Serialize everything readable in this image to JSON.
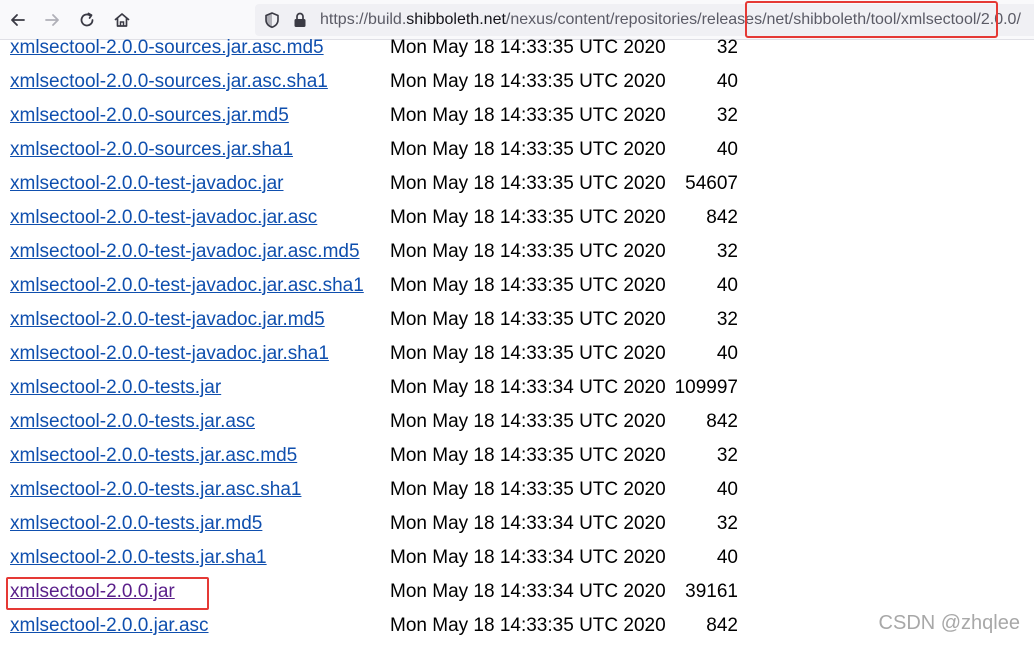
{
  "browser": {
    "url_host_prefix": "https://build.",
    "url_host": "shibboleth.net",
    "url_path": "/nexus/content/repositories/releases/net/shibboleth/tool/xmlsectool/2.0.0/"
  },
  "files": [
    {
      "name": "xmlsectool-2.0.0-sources.jar.asc.md5",
      "date": "Mon May 18 14:33:35 UTC 2020",
      "size": "32"
    },
    {
      "name": "xmlsectool-2.0.0-sources.jar.asc.sha1",
      "date": "Mon May 18 14:33:35 UTC 2020",
      "size": "40"
    },
    {
      "name": "xmlsectool-2.0.0-sources.jar.md5",
      "date": "Mon May 18 14:33:35 UTC 2020",
      "size": "32"
    },
    {
      "name": "xmlsectool-2.0.0-sources.jar.sha1",
      "date": "Mon May 18 14:33:35 UTC 2020",
      "size": "40"
    },
    {
      "name": "xmlsectool-2.0.0-test-javadoc.jar",
      "date": "Mon May 18 14:33:35 UTC 2020",
      "size": "54607"
    },
    {
      "name": "xmlsectool-2.0.0-test-javadoc.jar.asc",
      "date": "Mon May 18 14:33:35 UTC 2020",
      "size": "842"
    },
    {
      "name": "xmlsectool-2.0.0-test-javadoc.jar.asc.md5",
      "date": "Mon May 18 14:33:35 UTC 2020",
      "size": "32"
    },
    {
      "name": "xmlsectool-2.0.0-test-javadoc.jar.asc.sha1",
      "date": "Mon May 18 14:33:35 UTC 2020",
      "size": "40"
    },
    {
      "name": "xmlsectool-2.0.0-test-javadoc.jar.md5",
      "date": "Mon May 18 14:33:35 UTC 2020",
      "size": "32"
    },
    {
      "name": "xmlsectool-2.0.0-test-javadoc.jar.sha1",
      "date": "Mon May 18 14:33:35 UTC 2020",
      "size": "40"
    },
    {
      "name": "xmlsectool-2.0.0-tests.jar",
      "date": "Mon May 18 14:33:34 UTC 2020",
      "size": "109997"
    },
    {
      "name": "xmlsectool-2.0.0-tests.jar.asc",
      "date": "Mon May 18 14:33:35 UTC 2020",
      "size": "842"
    },
    {
      "name": "xmlsectool-2.0.0-tests.jar.asc.md5",
      "date": "Mon May 18 14:33:35 UTC 2020",
      "size": "32"
    },
    {
      "name": "xmlsectool-2.0.0-tests.jar.asc.sha1",
      "date": "Mon May 18 14:33:35 UTC 2020",
      "size": "40"
    },
    {
      "name": "xmlsectool-2.0.0-tests.jar.md5",
      "date": "Mon May 18 14:33:34 UTC 2020",
      "size": "32"
    },
    {
      "name": "xmlsectool-2.0.0-tests.jar.sha1",
      "date": "Mon May 18 14:33:34 UTC 2020",
      "size": "40"
    },
    {
      "name": "xmlsectool-2.0.0.jar",
      "date": "Mon May 18 14:33:34 UTC 2020",
      "size": "39161",
      "visited": true
    },
    {
      "name": "xmlsectool-2.0.0.jar.asc",
      "date": "Mon May 18 14:33:35 UTC 2020",
      "size": "842"
    }
  ],
  "watermark": "CSDN @zhqlee",
  "icons": {
    "back": "arrow-left-icon",
    "forward": "arrow-right-icon",
    "reload": "reload-icon",
    "home": "home-icon",
    "tracking": "shield-icon",
    "lock": "lock-icon"
  },
  "colors": {
    "link": "#0f4fae",
    "visited_link": "#5a1f8a",
    "annotation": "#e53935"
  }
}
